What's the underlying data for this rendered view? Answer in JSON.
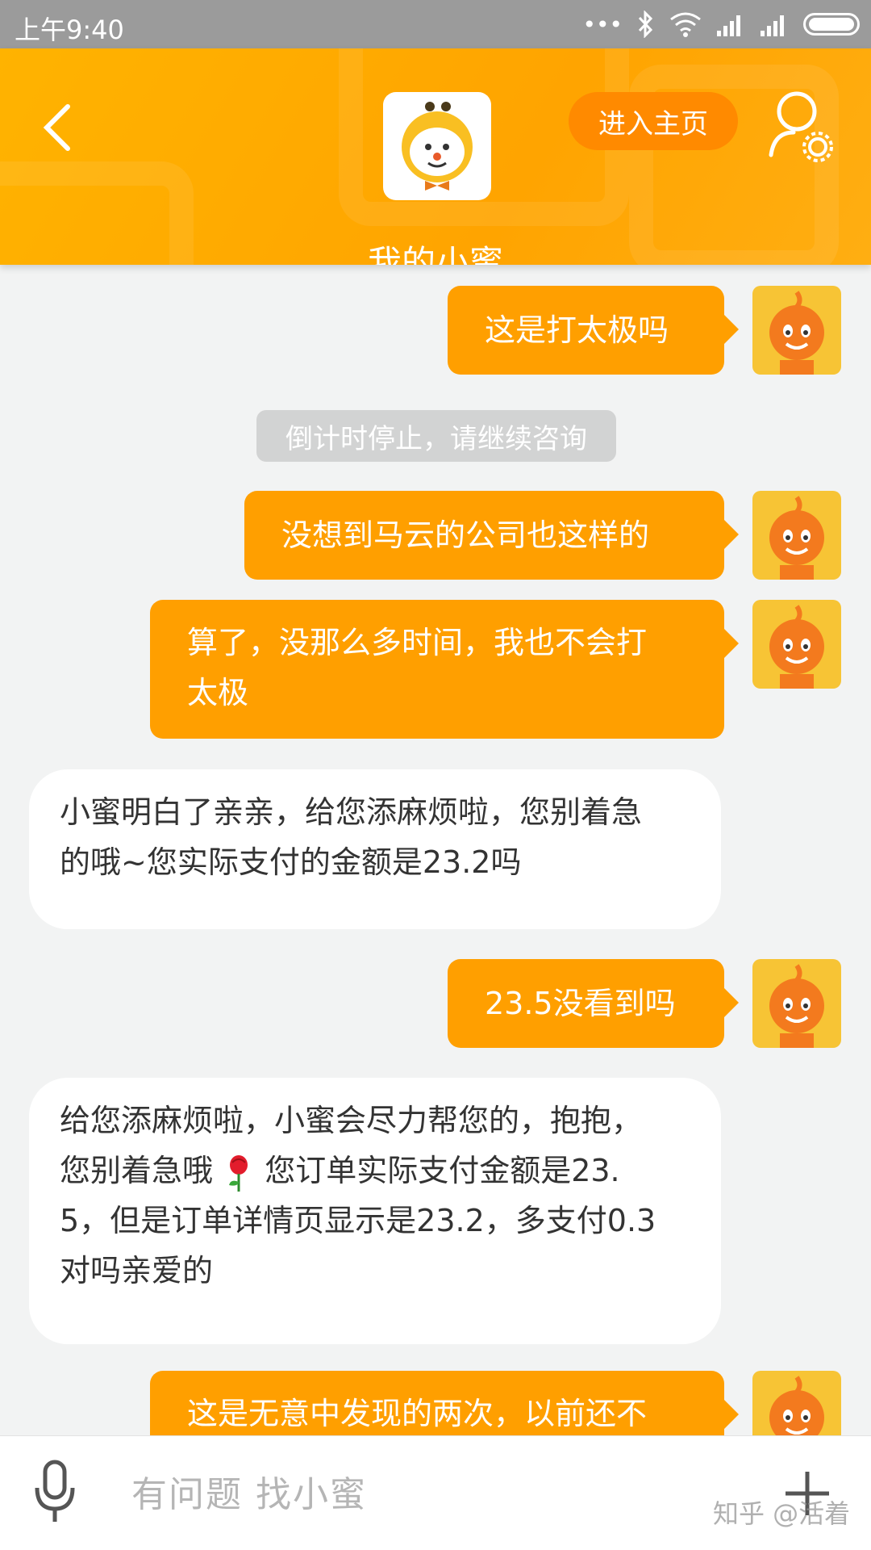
{
  "status_bar": {
    "time": "上午9:40",
    "signal_dots": "•••"
  },
  "header": {
    "title": "我的小蜜",
    "home_button_label": "进入主页",
    "back_icon": "chevron-left-icon",
    "profile_icon": "user-settings-icon",
    "avatar_icon": "bee-mascot-icon"
  },
  "chat": {
    "system_note": "倒计时停止，请继续咨询",
    "messages": [
      {
        "from": "user",
        "text": "这是打太极吗"
      },
      {
        "from": "user",
        "text": "没想到马云的公司也这样的"
      },
      {
        "from": "user",
        "text_line1": "算了，没那么多时间，我也不会打",
        "text_line2": "太极"
      },
      {
        "from": "bot",
        "text_line1": "小蜜明白了亲亲，给您添麻烦啦，您别着急",
        "text_line2": "的哦~您实际支付的金额是23.2吗"
      },
      {
        "from": "user",
        "text": "23.5没看到吗"
      },
      {
        "from": "bot",
        "text_line1": "给您添麻烦啦，小蜜会尽力帮您的，抱抱，",
        "text_line2a": "您别着急哦",
        "text_line2b": " 您订单实际支付金额是23.",
        "text_line3": "5，但是订单详情页显示是23.2，多支付0.3",
        "text_line4": "对吗亲爱的"
      },
      {
        "from": "user",
        "text": "这是无意中发现的两次，以前还不"
      }
    ]
  },
  "input_bar": {
    "placeholder": "有问题  找小蜜",
    "mic_icon": "microphone-icon",
    "plus_icon": "plus-icon"
  },
  "watermark": "知乎 @活着",
  "colors": {
    "header_orange": "#ffa400",
    "bubble_orange": "#ff9f00",
    "home_button": "#ff8a00",
    "bot_bubble": "#ffffff"
  }
}
